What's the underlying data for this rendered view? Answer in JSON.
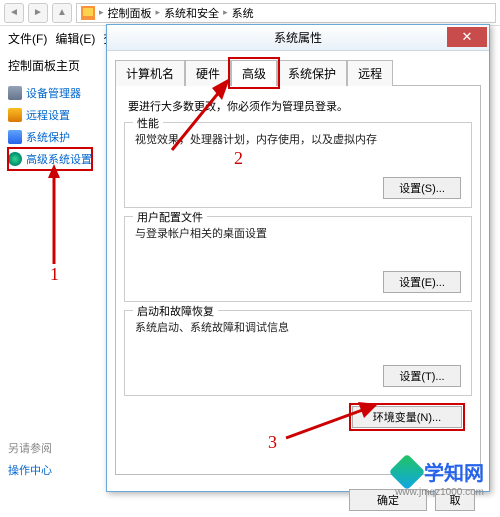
{
  "breadcrumb": {
    "p1": "控制面板",
    "p2": "系统和安全",
    "p3": "系统"
  },
  "menu": {
    "file": "文件(F)",
    "edit": "编辑(E)",
    "view": "查"
  },
  "sidebar": {
    "title": "控制面板主页",
    "items": [
      "设备管理器",
      "远程设置",
      "系统保护",
      "高级系统设置"
    ],
    "see_also": "另请参阅",
    "sub": "操作中心"
  },
  "dialog": {
    "title": "系统属性",
    "tabs": [
      "计算机名",
      "硬件",
      "高级",
      "系统保护",
      "远程"
    ],
    "admin_note": "要进行大多数更改，你必须作为管理员登录。",
    "groups": {
      "perf": {
        "title": "性能",
        "desc": "视觉效果，处理器计划，内存使用，以及虚拟内存",
        "btn": "设置(S)..."
      },
      "profile": {
        "title": "用户配置文件",
        "desc": "与登录帐户相关的桌面设置",
        "btn": "设置(E)..."
      },
      "startup": {
        "title": "启动和故障恢复",
        "desc": "系统启动、系统故障和调试信息",
        "btn": "设置(T)..."
      }
    },
    "env_btn": "环境变量(N)...",
    "ok": "确定",
    "cancel": "取"
  },
  "annotations": {
    "n1": "1",
    "n2": "2",
    "n3": "3"
  },
  "watermark": {
    "text": "学知网",
    "url": "www.jmqz1000.com"
  }
}
